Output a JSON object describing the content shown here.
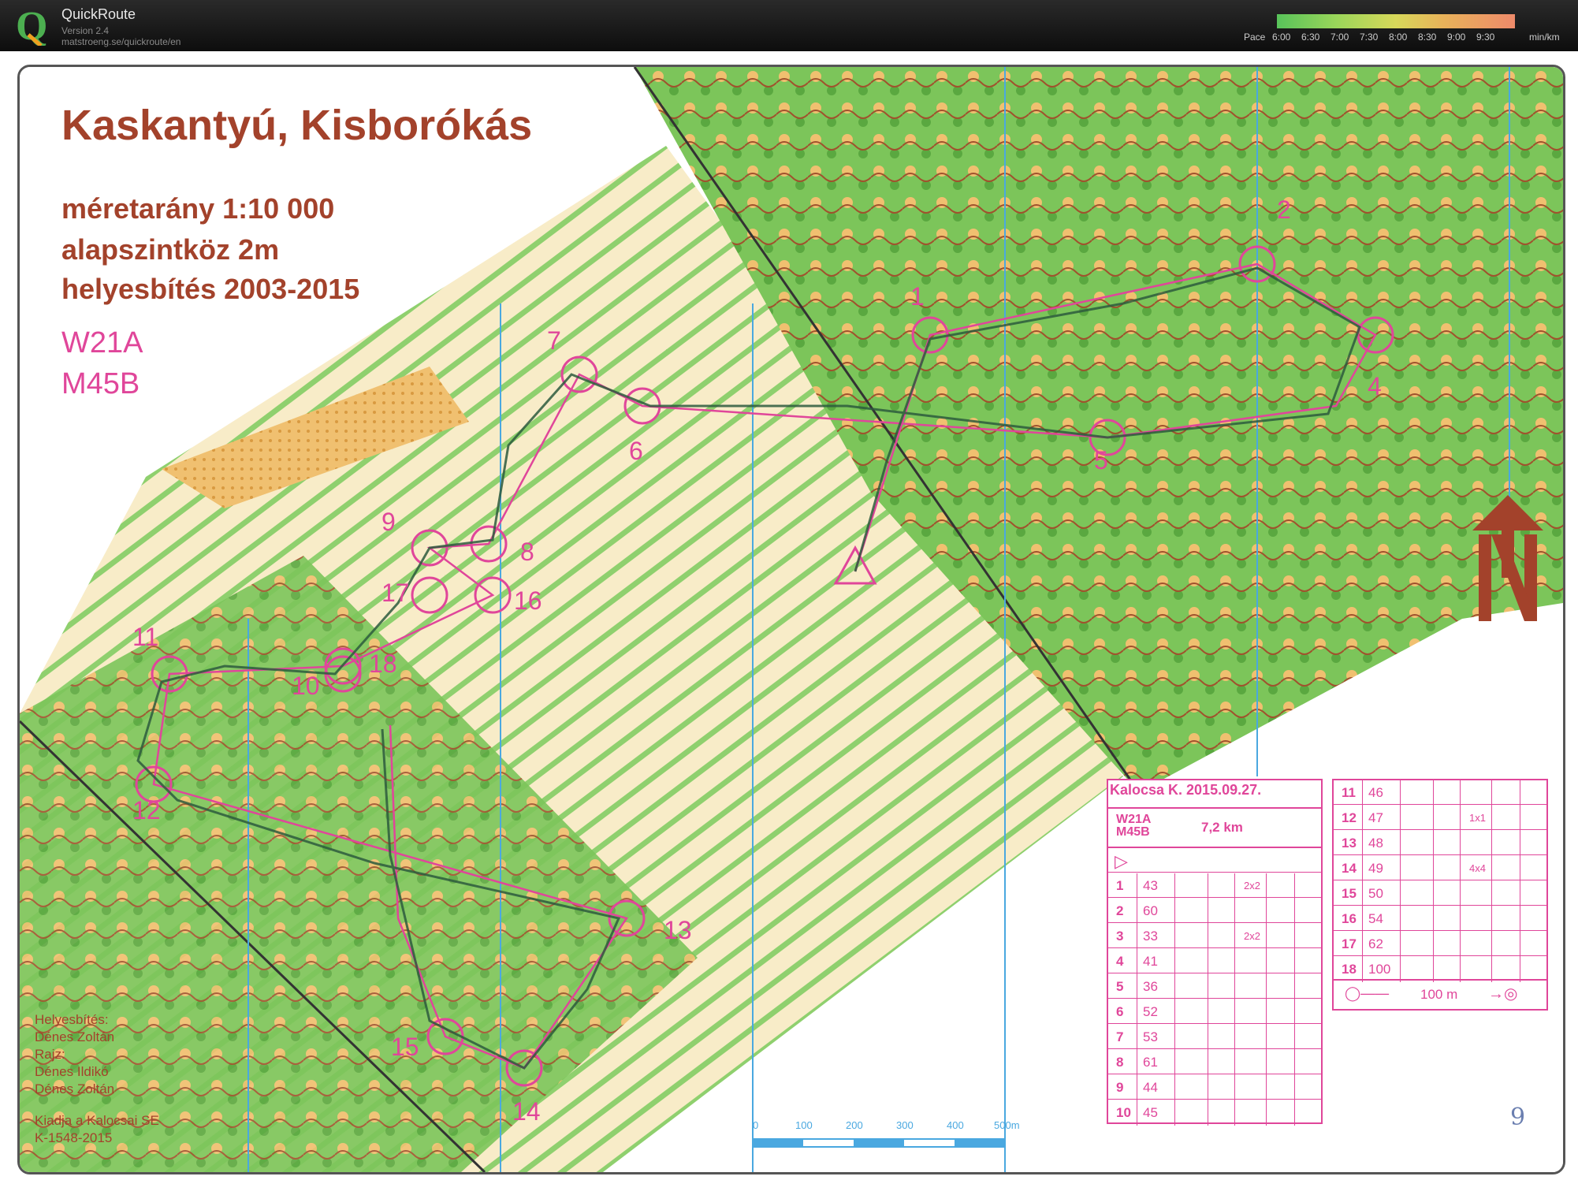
{
  "app": {
    "name": "QuickRoute",
    "version": "Version 2.4",
    "url": "matstroeng.se/quickroute/en"
  },
  "pace": {
    "label": "Pace",
    "ticks": [
      "6:00",
      "6:30",
      "7:00",
      "7:30",
      "8:00",
      "8:30",
      "9:00",
      "9:30"
    ],
    "unit": "min/km"
  },
  "map": {
    "title": "Kaskantyú, Kisborókás",
    "scale": "méretarány 1:10 000",
    "contour": "alapszintköz 2m",
    "revision": "helyesbítés 2003-2015",
    "class1": "W21A",
    "class2": "M45B",
    "credits": [
      "Helyesbítés:",
      "Dénes Zoltán",
      "Rajz:",
      "Dénes Ildikó",
      "Dénes Zoltán"
    ],
    "publisher": [
      "Kiadja a Kalocsai SE",
      "K-1548-2015"
    ],
    "scalebar_labels": [
      "0",
      "100",
      "200",
      "300",
      "400",
      "500m"
    ],
    "corner_mark": "9",
    "colors": {
      "route_pink": "#e0469a",
      "text_brown": "#a3422b",
      "forest_green": "#6fc24a",
      "open_yellow": "#f2c36b"
    }
  },
  "controls": [
    "1",
    "2",
    "4",
    "5",
    "6",
    "7",
    "8",
    "9",
    "10",
    "11",
    "12",
    "13",
    "14",
    "15",
    "16",
    "17",
    "18"
  ],
  "description": {
    "event": "Kalocsa K. 2015.09.27.",
    "classes": "W21A M45B",
    "length": "7,2 km",
    "rows": [
      {
        "n": "1",
        "code": "43",
        "extra": "2x2"
      },
      {
        "n": "2",
        "code": "60",
        "extra": ""
      },
      {
        "n": "3",
        "code": "33",
        "extra": "2x2"
      },
      {
        "n": "4",
        "code": "41",
        "extra": ""
      },
      {
        "n": "5",
        "code": "36",
        "extra": ""
      },
      {
        "n": "6",
        "code": "52",
        "extra": ""
      },
      {
        "n": "7",
        "code": "53",
        "extra": ""
      },
      {
        "n": "8",
        "code": "61",
        "extra": ""
      },
      {
        "n": "9",
        "code": "44",
        "extra": ""
      },
      {
        "n": "10",
        "code": "45",
        "extra": ""
      }
    ],
    "rows2": [
      {
        "n": "11",
        "code": "46",
        "extra": ""
      },
      {
        "n": "12",
        "code": "47",
        "extra": "1x1"
      },
      {
        "n": "13",
        "code": "48",
        "extra": ""
      },
      {
        "n": "14",
        "code": "49",
        "extra": "4x4"
      },
      {
        "n": "15",
        "code": "50",
        "extra": ""
      },
      {
        "n": "16",
        "code": "54",
        "extra": ""
      },
      {
        "n": "17",
        "code": "62",
        "extra": ""
      },
      {
        "n": "18",
        "code": "100",
        "extra": ""
      }
    ],
    "finish": "100 m"
  }
}
